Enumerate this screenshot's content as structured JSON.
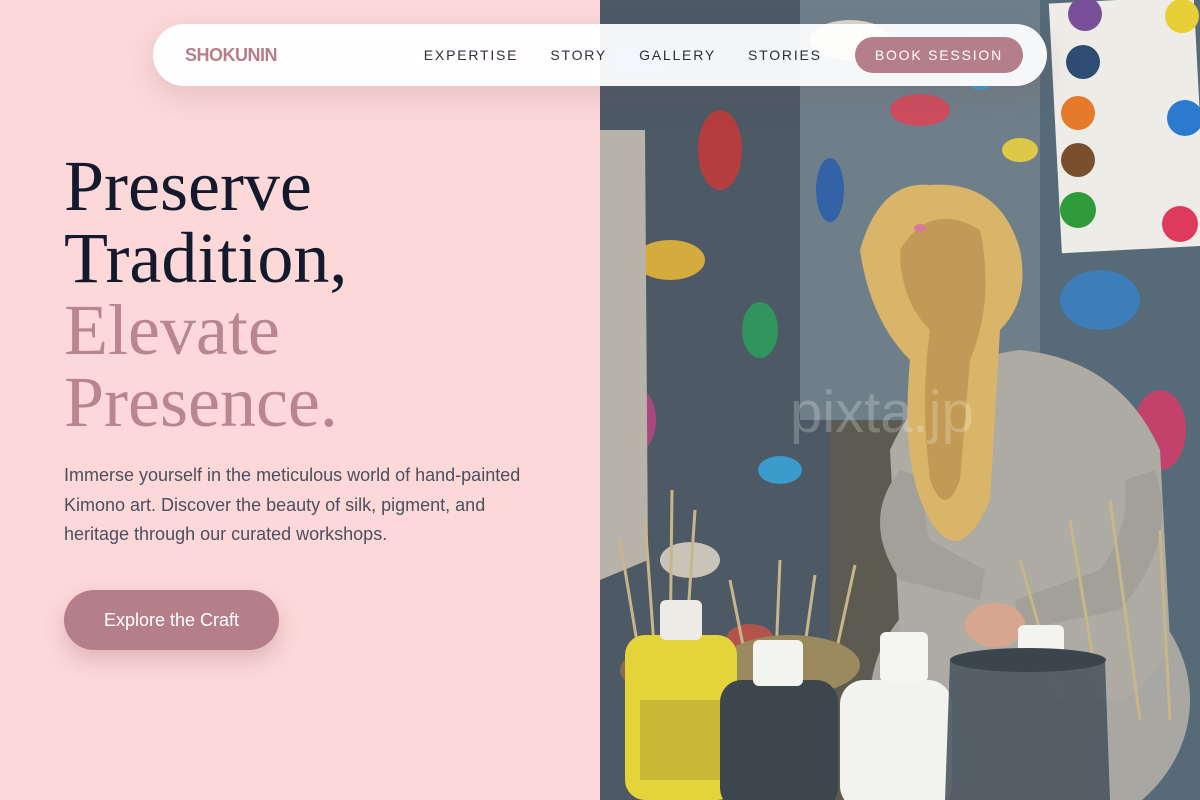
{
  "brand": {
    "name": "SHOKUNIN"
  },
  "nav": {
    "links": [
      "EXPERTISE",
      "STORY",
      "GALLERY",
      "STORIES"
    ],
    "cta_label": "BOOK SESSION"
  },
  "hero": {
    "headline_line1": "Preserve",
    "headline_line2": "Tradition,",
    "headline_line3": "Elevate",
    "headline_line4": "Presence.",
    "description": "Immerse yourself in the meticulous world of hand-painted Kimono art. Discover the beauty of silk, pigment, and heritage through our curated workshops.",
    "cta_label": "Explore the Craft",
    "image_watermark": "pixta.jp"
  },
  "colors": {
    "background": "#fcd8d9",
    "accent": "#b47f8a",
    "heading_dark": "#141a2e",
    "heading_muted": "#b9868e",
    "body_text": "#4c4f5e"
  }
}
